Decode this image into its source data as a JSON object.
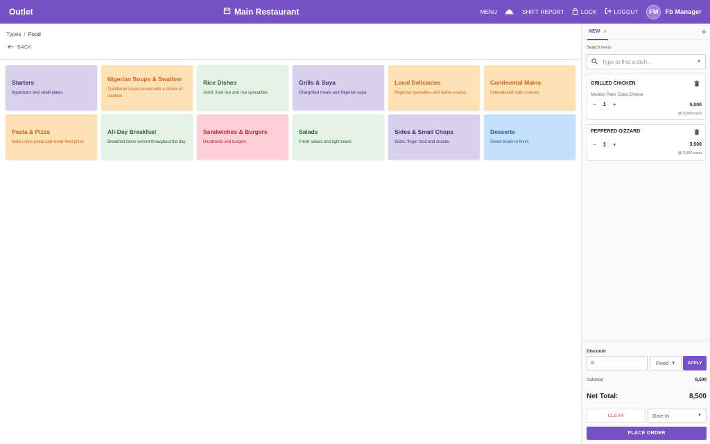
{
  "header": {
    "brand": "Outlet",
    "restaurant": "Main Restaurant",
    "nav": [
      {
        "label": "MENU",
        "icon": "menu"
      },
      {
        "label": "SHIFT REPORT",
        "icon": "cloche-icon"
      },
      {
        "label": "LOCK",
        "icon": "lock-icon"
      },
      {
        "label": "LOGOUT",
        "icon": "logout-icon"
      }
    ],
    "avatar_initials": "FM",
    "username": "Fb Manager"
  },
  "breadcrumb": {
    "parent": "Types",
    "separator": "/",
    "current": "Food"
  },
  "back_label": "BACK",
  "categories": [
    {
      "title": "Starters",
      "desc": "Appetizers and small plates",
      "bg": "#d9d0ee",
      "fg": "#3f2f6e"
    },
    {
      "title": "Nigerian Soups & Swallow",
      "desc": "Traditional soups served with a choice of swallow",
      "bg": "#fde0b4",
      "fg": "#c8641a"
    },
    {
      "title": "Rice Dishes",
      "desc": "Jollof, fried rice and rice specialties",
      "bg": "#e4f3e5",
      "fg": "#2c5e2e"
    },
    {
      "title": "Grills & Suya",
      "desc": "Chargrilled meats and Nigerian suya",
      "bg": "#d9d0ee",
      "fg": "#3f2f6e"
    },
    {
      "title": "Local Delicacies",
      "desc": "Regional specialties and native snacks",
      "bg": "#fde0b4",
      "fg": "#c8641a"
    },
    {
      "title": "Continental Mains",
      "desc": "International main courses",
      "bg": "#fde0b4",
      "fg": "#c8641a"
    },
    {
      "title": "Pasta & Pizza",
      "desc": "Italian-style pasta and wood-fired pizza",
      "bg": "#fde0b4",
      "fg": "#c8641a"
    },
    {
      "title": "All-Day Breakfast",
      "desc": "Breakfast items served throughout the day",
      "bg": "#e4f3e5",
      "fg": "#2c5e2e"
    },
    {
      "title": "Sandwiches & Burgers",
      "desc": "Handhelds and burgers",
      "bg": "#fcd0d6",
      "fg": "#b8243a"
    },
    {
      "title": "Salads",
      "desc": "Fresh salads and light bowls",
      "bg": "#e4f3e5",
      "fg": "#2c5e2e"
    },
    {
      "title": "Sides & Small Chops",
      "desc": "Sides, finger food and snacks",
      "bg": "#d9d0ee",
      "fg": "#3f2f6e"
    },
    {
      "title": "Desserts",
      "desc": "Sweet treats to finish",
      "bg": "#c5e0fb",
      "fg": "#1d5a9c"
    }
  ],
  "panel": {
    "tab_label": "NEW",
    "tab_close": "×",
    "add_tab": "+",
    "search_label": "Search menu",
    "search_placeholder": "Type to find a dish...",
    "order_items": [
      {
        "name": "GRILLED CHICKEN",
        "mods": "Medium Rare, Extra Cheese",
        "qty": "1",
        "price": "5,000",
        "each": "@ 5,000 each"
      },
      {
        "name": "PEPPERED GIZZARD",
        "mods": "",
        "qty": "1",
        "price": "3,500",
        "each": "@ 3,500 each"
      }
    ],
    "discount_label": "Discount",
    "discount_value": "0",
    "discount_type": "Fixed",
    "apply_label": "APPLY",
    "subtotal_label": "Subtotal",
    "subtotal_value": "8,500",
    "net_total_label": "Net Total:",
    "net_total_value": "8,500",
    "clear_label": "CLEAR",
    "dine_option": "Dine-In",
    "place_order_label": "PLACE ORDER"
  },
  "colors": {
    "accent": "#7652c5"
  }
}
